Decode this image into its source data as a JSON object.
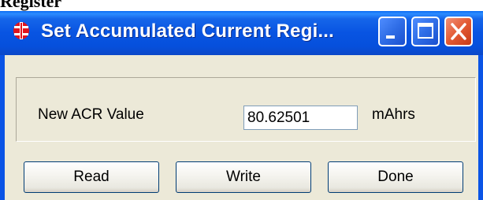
{
  "page": {
    "heading": "Register"
  },
  "window": {
    "title": "Set Accumulated Current Regi...",
    "controls": {
      "minimize": "minimize-icon",
      "maximize": "maximize-icon",
      "close": "close-icon"
    },
    "colors": {
      "titlebar": "#0854e2",
      "client": "#ece9d8",
      "close_button": "#e35a33"
    }
  },
  "form": {
    "acr_label": "New ACR Value",
    "acr_value": "80.62501",
    "unit": "mAhrs"
  },
  "buttons": {
    "read": "Read",
    "write": "Write",
    "done": "Done"
  }
}
